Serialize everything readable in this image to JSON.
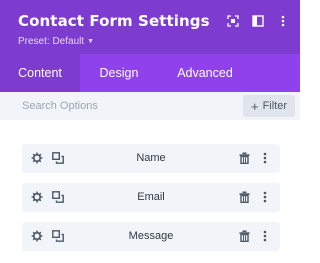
{
  "header": {
    "title": "Contact Form Settings",
    "preset_label": "Preset: Default",
    "icons": [
      "focus-icon",
      "sidebar-layout-icon",
      "more-vertical-icon"
    ]
  },
  "tabs": [
    {
      "label": "Content",
      "active": true
    },
    {
      "label": "Design",
      "active": false
    },
    {
      "label": "Advanced",
      "active": false
    }
  ],
  "search": {
    "placeholder": "Search Options",
    "filter_label": "Filter"
  },
  "fields": [
    {
      "label": "Name"
    },
    {
      "label": "Email"
    },
    {
      "label": "Message"
    }
  ],
  "colors": {
    "header_bg": "#7e3bd0",
    "tabs_bg": "#8f42ec",
    "row_bg": "#f1f5f9"
  }
}
